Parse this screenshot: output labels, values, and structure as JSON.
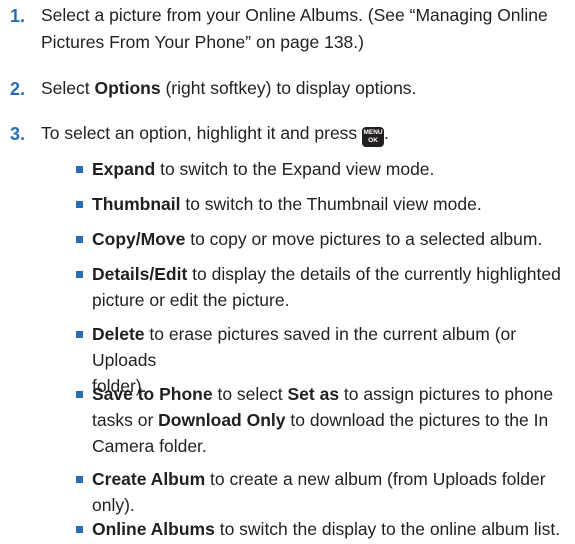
{
  "steps": [
    {
      "num": "1.",
      "line1": "Select a picture from your Online Albums. (See “Managing Online",
      "line2": "Pictures From Your Phone” on page 138.)"
    },
    {
      "num": "2.",
      "pre": "Select ",
      "bold": "Options",
      "post": " (right softkey) to display options."
    },
    {
      "num": "3.",
      "pre": "To select an option, highlight it and press",
      "key_top": "MENU",
      "key_bottom": "OK",
      "post": "."
    }
  ],
  "options": [
    {
      "bold": "Expand",
      "text": " to switch to the Expand view mode."
    },
    {
      "bold": "Thumbnail",
      "text": " to switch to the Thumbnail view mode."
    },
    {
      "bold": "Copy/Move",
      "text": " to copy or move pictures to a selected album."
    },
    {
      "bold": "Details/Edit",
      "text": " to display the details of the currently highlighted",
      "text2": "picture or edit the picture."
    },
    {
      "bold": "Delete",
      "text": " to erase pictures saved in the current album (or Uploads",
      "text2": "folder)."
    },
    {
      "bold": "Save to Phone",
      "text": " to select ",
      "bold2": "Set as",
      "text_b": " to assign pictures to phone",
      "text2a": "tasks or ",
      "bold3": "Download Only",
      "text2b": " to download the pictures to the In",
      "text3": "Camera folder."
    },
    {
      "bold": "Create Album",
      "text": " to create a new album (from Uploads folder",
      "text2": "only)."
    },
    {
      "bold": "Online Albums",
      "text": " to switch the display to the online album list."
    }
  ],
  "colors": {
    "accent": "#2b6db5",
    "text": "#231f20"
  }
}
